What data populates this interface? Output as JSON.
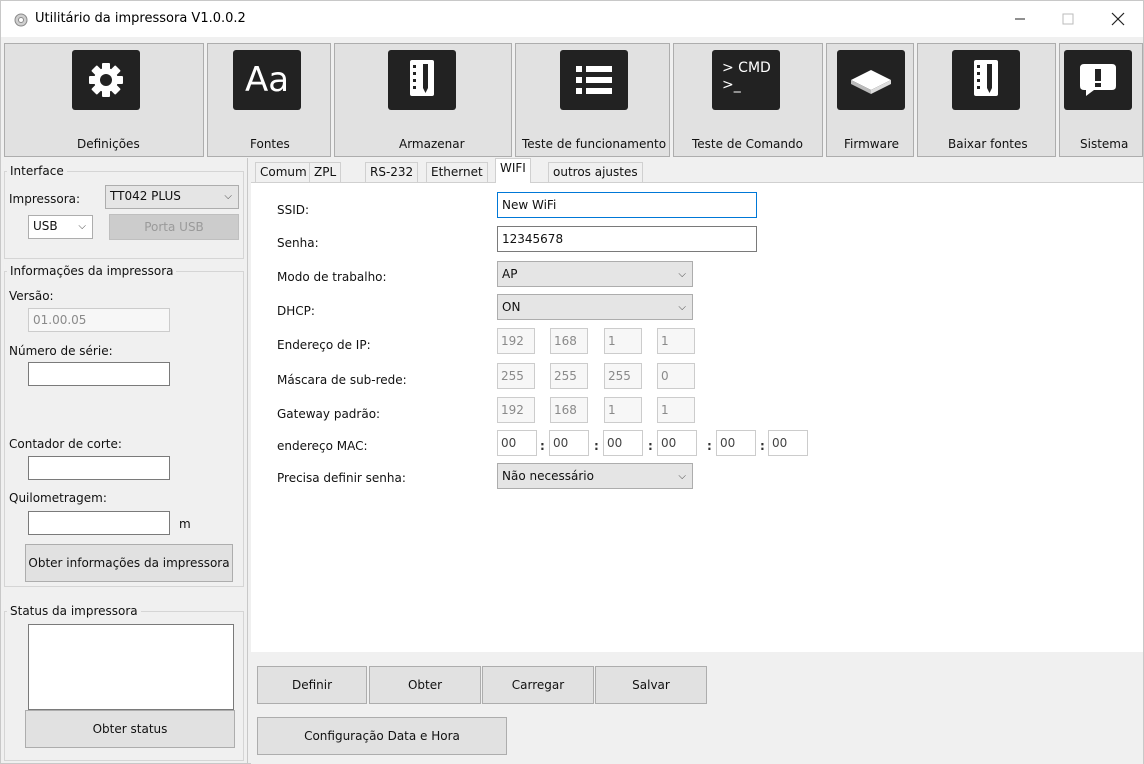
{
  "window": {
    "title": "Utilitário da impressora  V1.0.0.2",
    "controls": {
      "minimize": "—",
      "maximize": "☐",
      "close": "✕"
    }
  },
  "toolbar": {
    "definicoes": "Definições",
    "fontes": "Fontes",
    "fontes_icon_text": "Aa",
    "armazenar": "Armazenar",
    "teste_funcionamento": "Teste de funcionamento",
    "teste_comando": "Teste de Comando",
    "cmd_icon_line1": "> CMD",
    "cmd_icon_line2": ">_",
    "firmware": "Firmware",
    "baixar_fontes": "Baixar fontes",
    "sistema": "Sistema"
  },
  "left": {
    "interface_title": "Interface",
    "impressora_label": "Impressora:",
    "impressora_value": "TT042 PLUS",
    "port_value": "USB",
    "porta_usb_button": "Porta USB",
    "info_title": "Informações da impressora",
    "versao_label": "Versão:",
    "versao_value": "01.00.05",
    "serie_label": "Número de série:",
    "serie_value": "",
    "contador_label": "Contador de corte:",
    "contador_value": "",
    "quilometragem_label": "Quilometragem:",
    "quilometragem_value": "",
    "quilometragem_unit": "m",
    "obter_info_button": "Obter informações da impressora",
    "status_title": "Status da impressora",
    "status_text": "",
    "obter_status_button": "Obter status"
  },
  "tabs": [
    "Comum",
    "ZPL",
    "RS-232",
    "Ethernet",
    "WIFI",
    "outros ajustes"
  ],
  "active_tab": "WIFI",
  "wifi": {
    "ssid_label": "SSID:",
    "ssid_value": "New WiFi",
    "senha_label": "Senha:",
    "senha_value": "12345678",
    "modo_label": "Modo de trabalho:",
    "modo_value": "AP",
    "dhcp_label": "DHCP:",
    "dhcp_value": "ON",
    "ip_label": "Endereço de IP:",
    "ip": [
      "192",
      "168",
      "1",
      "1"
    ],
    "mask_label": "Máscara de sub-rede:",
    "mask": [
      "255",
      "255",
      "255",
      "0"
    ],
    "gateway_label": "Gateway padrão:",
    "gateway": [
      "192",
      "168",
      "1",
      "1"
    ],
    "mac_label": "endereço MAC:",
    "mac": [
      "00",
      "00",
      "00",
      "00",
      "00",
      "00"
    ],
    "mac_separator": ":",
    "senha_req_label": "Precisa definir senha:",
    "senha_req_value": "Não necessário"
  },
  "actions": {
    "definir": "Definir",
    "obter": "Obter",
    "carregar": "Carregar",
    "salvar": "Salvar",
    "data_hora": "Configuração Data e Hora"
  }
}
